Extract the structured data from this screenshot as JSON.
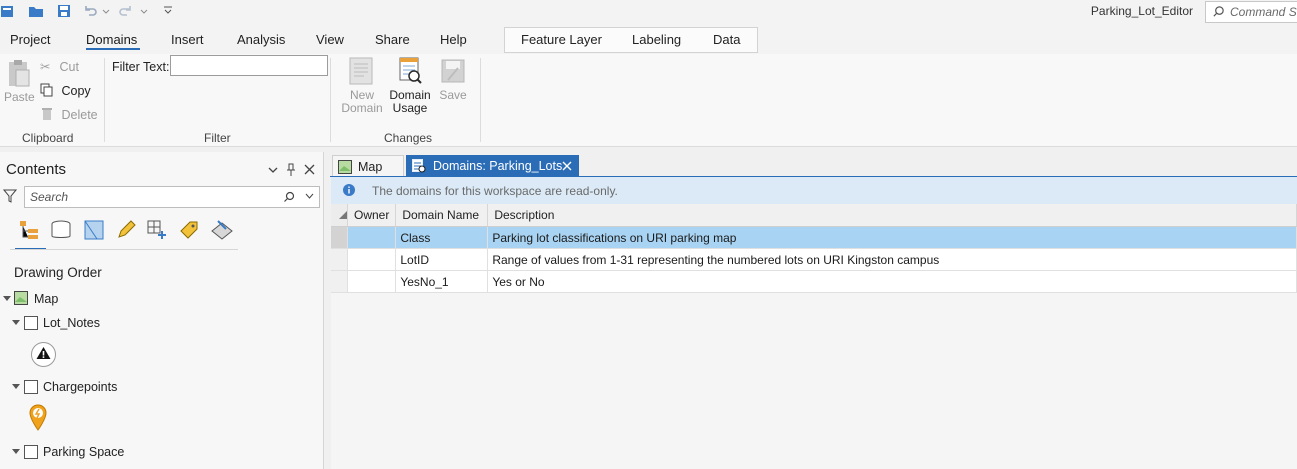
{
  "app": {
    "title": "Parking_Lot_Editor"
  },
  "command_search": {
    "placeholder": "Command Search"
  },
  "ribbon_tabs": [
    "Project",
    "Domains",
    "Insert",
    "Analysis",
    "View",
    "Share",
    "Help"
  ],
  "contextual_tabs": [
    "Feature Layer",
    "Labeling",
    "Data"
  ],
  "clipboard": {
    "paste": "Paste",
    "cut": "Cut",
    "copy": "Copy",
    "delete": "Delete",
    "group_label": "Clipboard"
  },
  "filter": {
    "label": "Filter Text:",
    "value": "",
    "group_label": "Filter"
  },
  "changes": {
    "new_domain_1": "New",
    "new_domain_2": "Domain",
    "usage_1": "Domain",
    "usage_2": "Usage",
    "save": "Save",
    "group_label": "Changes"
  },
  "contents": {
    "title": "Contents",
    "search_placeholder": "Search",
    "drawing_order": "Drawing Order",
    "map_label": "Map",
    "layers": [
      "Lot_Notes",
      "Chargepoints",
      "Parking Space"
    ]
  },
  "doc_tabs": {
    "map": "Map",
    "domains": "Domains: Parking_Lots"
  },
  "info_message": "The domains for this workspace are read-only.",
  "grid": {
    "headers": [
      "Owner",
      "Domain Name",
      "Description"
    ],
    "rows": [
      {
        "owner": "",
        "name": "Class",
        "description": "Parking lot classifications on URI parking map",
        "selected": true
      },
      {
        "owner": "",
        "name": "LotID",
        "description": "Range of values from 1-31 representing the numbered lots on URI Kingston campus",
        "selected": false
      },
      {
        "owner": "",
        "name": "YesNo_1",
        "description": "Yes or No",
        "selected": false
      }
    ]
  },
  "colors": {
    "accent": "#2b6cb7",
    "selected_row": "#a8d3f2",
    "info_bar": "#dbeaf6",
    "active_tab": "#2b6cb7"
  }
}
